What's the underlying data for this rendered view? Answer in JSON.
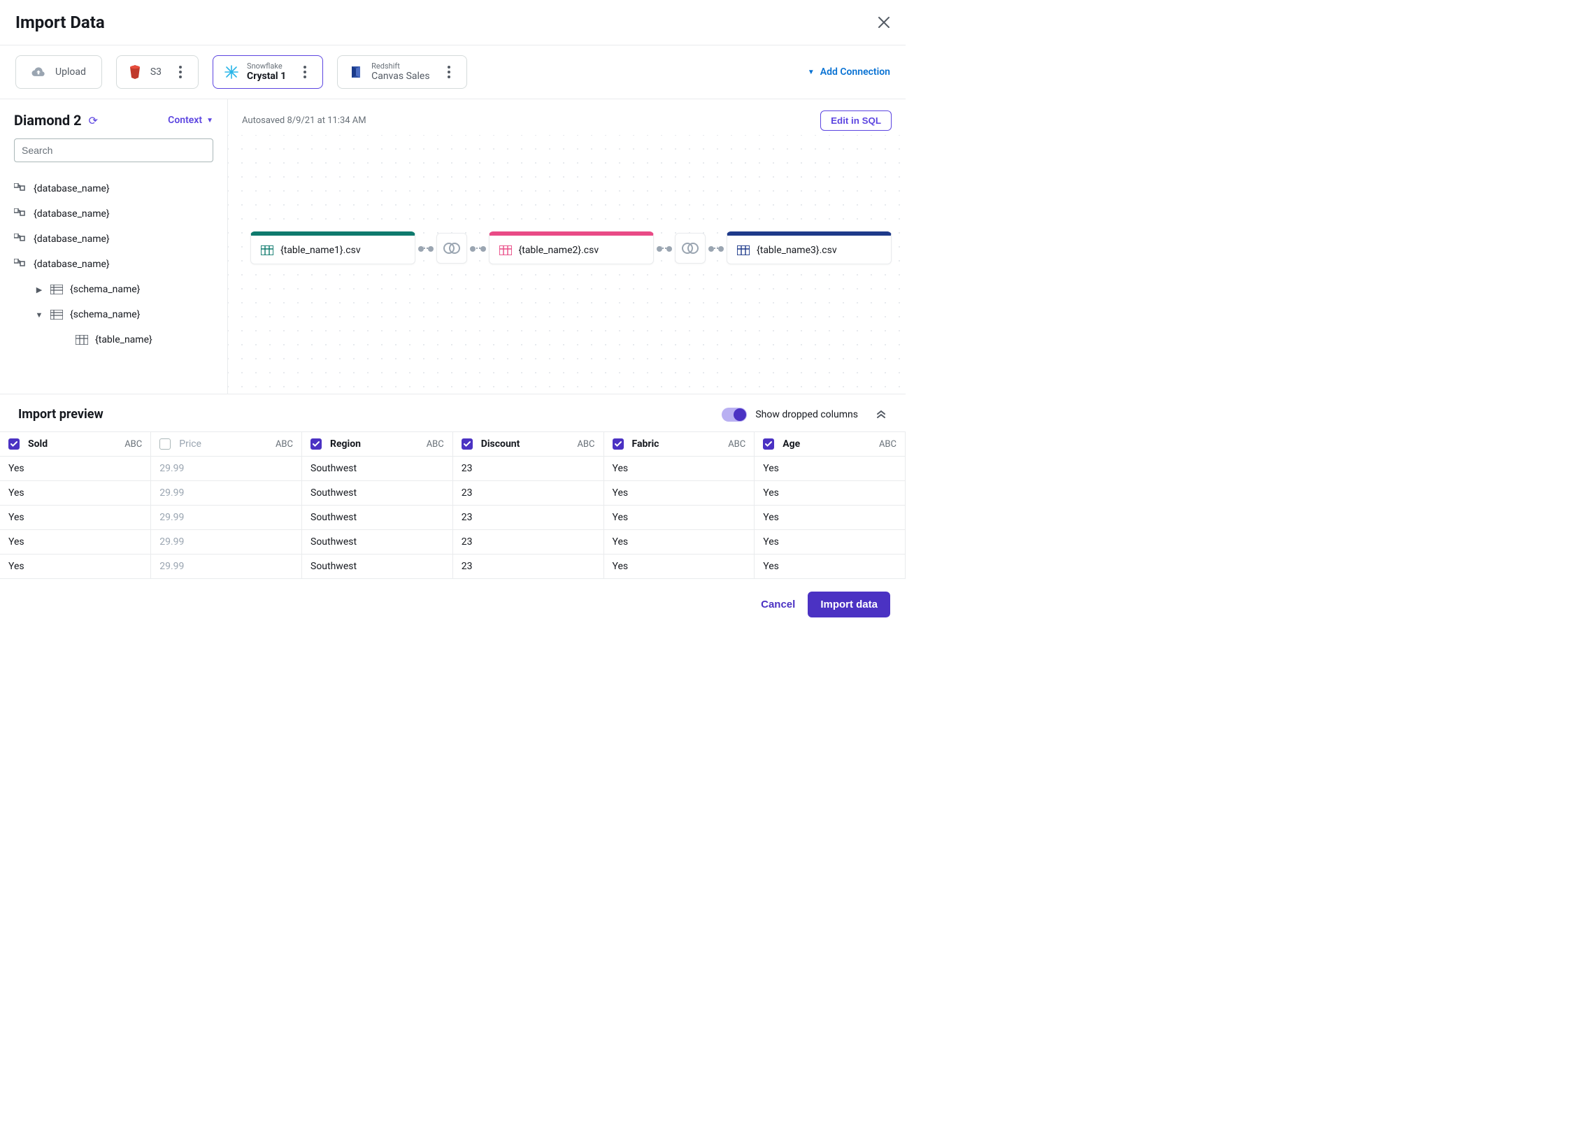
{
  "header": {
    "title": "Import Data"
  },
  "connections": {
    "upload_label": "Upload",
    "s3_label": "S3",
    "snowflake": {
      "sub": "Snowflake",
      "main": "Crystal 1"
    },
    "redshift": {
      "sub": "Redshift",
      "main": "Canvas Sales"
    },
    "add_label": "Add Connection"
  },
  "sidebar": {
    "dataset_name": "Diamond 2",
    "context_label": "Context",
    "search_placeholder": "Search",
    "tree": {
      "db_label": "{database_name}",
      "schema_label": "{schema_name}",
      "table_label": "{table_name}"
    }
  },
  "canvas": {
    "autosaved": "Autosaved 8/9/21 at 11:34 AM",
    "edit_sql": "Edit in SQL",
    "nodes": {
      "n1": "{table_name1}.csv",
      "n2": "{table_name2}.csv",
      "n3": "{table_name3}.csv"
    }
  },
  "preview": {
    "title": "Import preview",
    "toggle_label": "Show dropped columns",
    "type_tag": "ABC",
    "columns": [
      {
        "name": "Sold",
        "checked": true
      },
      {
        "name": "Price",
        "checked": false
      },
      {
        "name": "Region",
        "checked": true
      },
      {
        "name": "Discount",
        "checked": true
      },
      {
        "name": "Fabric",
        "checked": true
      },
      {
        "name": "Age",
        "checked": true
      }
    ],
    "rows": [
      [
        "Yes",
        "29.99",
        "Southwest",
        "23",
        "Yes",
        "Yes"
      ],
      [
        "Yes",
        "29.99",
        "Southwest",
        "23",
        "Yes",
        "Yes"
      ],
      [
        "Yes",
        "29.99",
        "Southwest",
        "23",
        "Yes",
        "Yes"
      ],
      [
        "Yes",
        "29.99",
        "Southwest",
        "23",
        "Yes",
        "Yes"
      ],
      [
        "Yes",
        "29.99",
        "Southwest",
        "23",
        "Yes",
        "Yes"
      ]
    ]
  },
  "footer": {
    "cancel": "Cancel",
    "import": "Import data"
  }
}
